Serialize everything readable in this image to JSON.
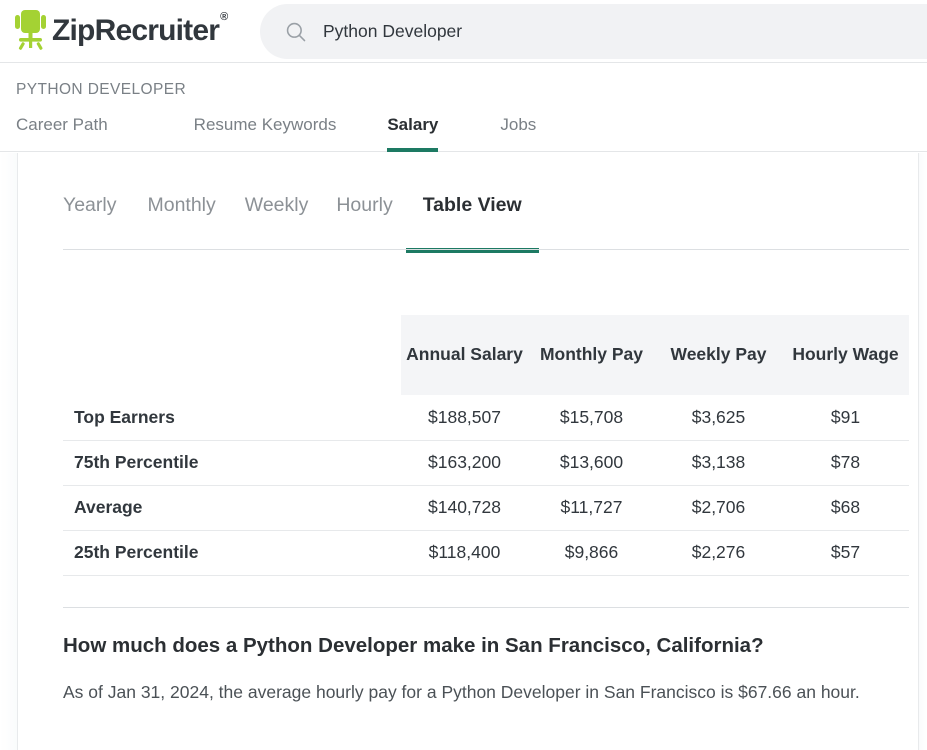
{
  "header": {
    "brand_name": "ZipRecruiter",
    "brand_registered": "®",
    "logo_icon": "office-chair-icon",
    "logo_color": "#a4d233",
    "search": {
      "icon": "search-icon",
      "value": "Python Developer",
      "placeholder": "Search jobs"
    }
  },
  "nav": {
    "kicker": "PYTHON DEVELOPER",
    "tabs": [
      {
        "label": "Career Path",
        "active": false
      },
      {
        "label": "Resume Keywords",
        "active": false
      },
      {
        "label": "Salary",
        "active": true
      },
      {
        "label": "Jobs",
        "active": false
      }
    ],
    "active_underline_color": "#1d7a63"
  },
  "subtabs": {
    "items": [
      {
        "label": "Yearly",
        "active": false
      },
      {
        "label": "Monthly",
        "active": false
      },
      {
        "label": "Weekly",
        "active": false
      },
      {
        "label": "Hourly",
        "active": false
      },
      {
        "label": "Table View",
        "active": true
      }
    ],
    "active_underline_color": "#1d7a63"
  },
  "table": {
    "corner_label": "",
    "columns": [
      "Annual Salary",
      "Monthly Pay",
      "Weekly Pay",
      "Hourly Wage"
    ],
    "rows": [
      {
        "label": "Top Earners",
        "annual": "$188,507",
        "monthly": "$15,708",
        "weekly": "$3,625",
        "hourly": "$91"
      },
      {
        "label": "75th Percentile",
        "annual": "$163,200",
        "monthly": "$13,600",
        "weekly": "$3,138",
        "hourly": "$78"
      },
      {
        "label": "Average",
        "annual": "$140,728",
        "monthly": "$11,727",
        "weekly": "$2,706",
        "hourly": "$68"
      },
      {
        "label": "25th Percentile",
        "annual": "$118,400",
        "monthly": "$9,866",
        "weekly": "$2,276",
        "hourly": "$57"
      }
    ]
  },
  "qa": {
    "heading": "How much does a Python Developer make in San Francisco, California?",
    "body": "As of Jan 31, 2024, the average hourly pay for a Python Developer in San Francisco is $67.66 an hour."
  }
}
